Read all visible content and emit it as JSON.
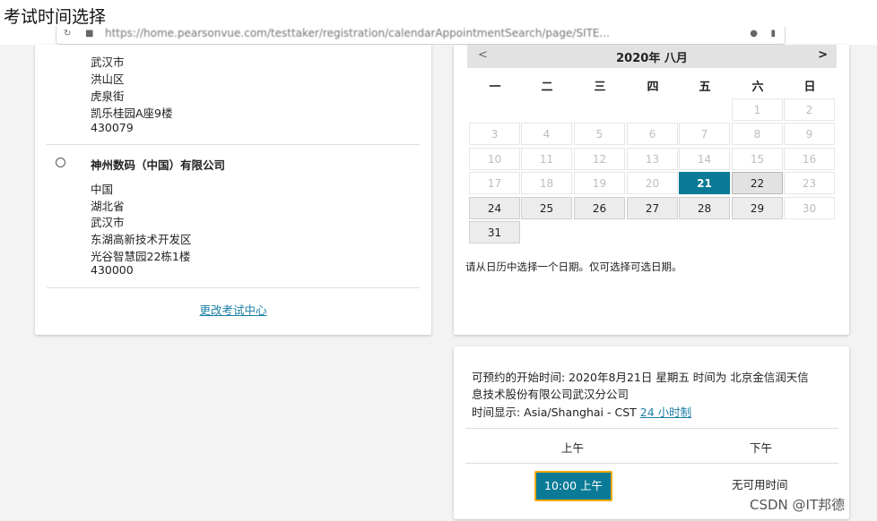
{
  "page": {
    "title": "考试时间选择"
  },
  "browser": {
    "url": "https://home.pearsonvue.com/testtaker/registration/calendarAppointmentSearch/page/SITE..."
  },
  "centers": {
    "first_address_lines": [
      "武汉市",
      "洪山区",
      "虎泉街",
      "凯乐桂园A座9楼",
      "430079"
    ],
    "second": {
      "name": "神州数码（中国）有限公司",
      "address_lines": [
        "中国",
        "湖北省",
        "武汉市",
        "东湖高新技术开发区",
        "光谷智慧园22栋1楼",
        "430000"
      ]
    },
    "change_link": "更改考试中心"
  },
  "calendar": {
    "month_label": "2020年 八月",
    "prev": "<",
    "next": ">",
    "weekdays": [
      "一",
      "二",
      "三",
      "四",
      "五",
      "六",
      "日"
    ],
    "days": [
      "1",
      "2",
      "3",
      "4",
      "5",
      "6",
      "7",
      "8",
      "9",
      "10",
      "11",
      "12",
      "13",
      "14",
      "15",
      "16",
      "17",
      "18",
      "19",
      "20",
      "21",
      "22",
      "23",
      "24",
      "25",
      "26",
      "27",
      "28",
      "29",
      "30",
      "31"
    ],
    "available_days": [
      21,
      22,
      24,
      25,
      26,
      27,
      28,
      29,
      31
    ],
    "selected_day": 21,
    "note": "请从日历中选择一个日期。仅可选择可选日期。"
  },
  "times": {
    "intro_line1": "可预约的开始时间:   2020年8月21日 星期五 时间为 北京金信润天信",
    "intro_line2": "息技术股份有限公司武汉分公司",
    "timezone_label": "时间显示:  Asia/Shanghai - CST",
    "format_link": "24   小时制",
    "am_label": "上午",
    "pm_label": "下午",
    "slot": "10:00 上午",
    "no_slots": "无可用时间"
  },
  "watermark": "CSDN @IT邦德"
}
